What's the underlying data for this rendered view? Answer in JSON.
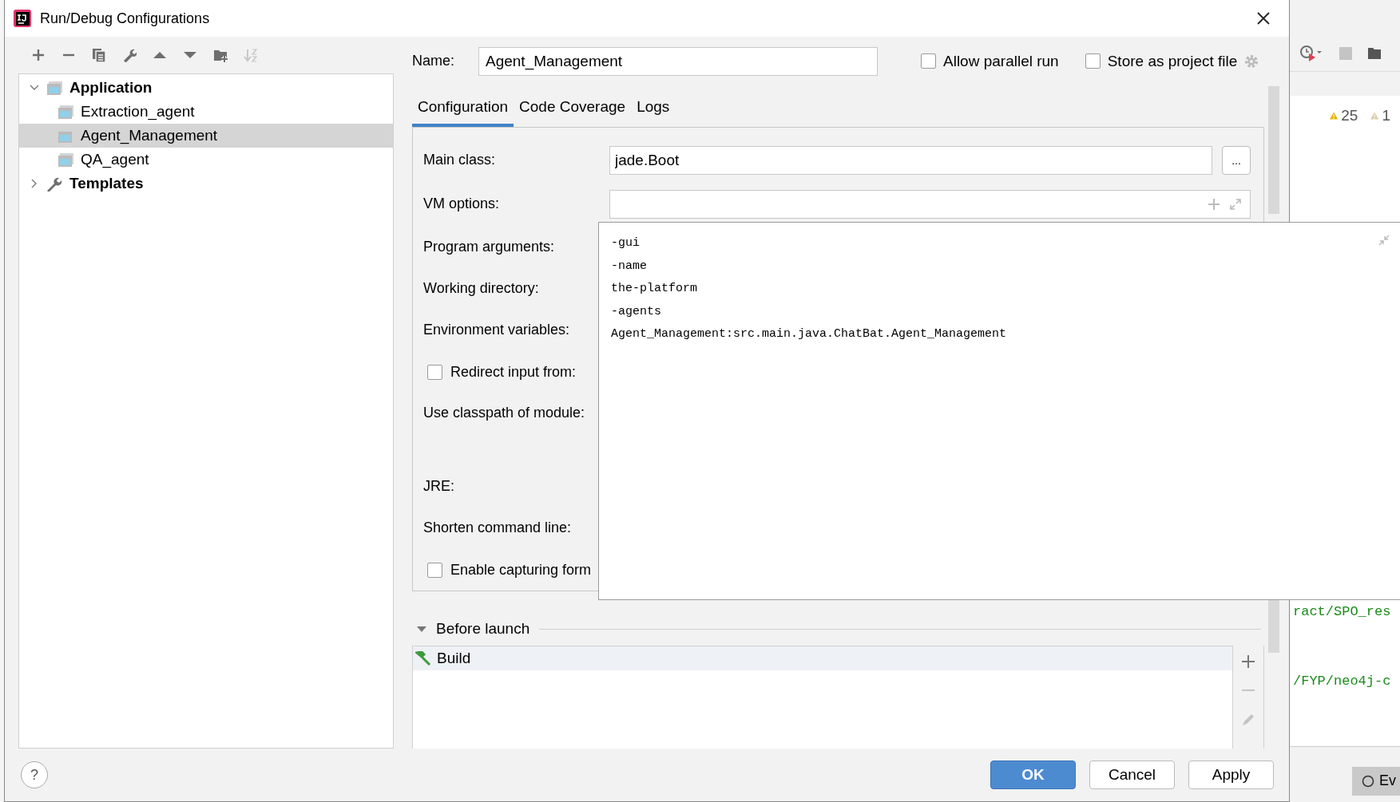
{
  "window": {
    "title": "Run/Debug Configurations"
  },
  "toolbar": [
    {
      "kind": "add",
      "disabled": false
    },
    {
      "kind": "remove",
      "disabled": false
    },
    {
      "kind": "copy",
      "disabled": false
    },
    {
      "kind": "edit",
      "disabled": false
    },
    {
      "kind": "up",
      "disabled": false
    },
    {
      "kind": "down",
      "disabled": false
    },
    {
      "kind": "folder",
      "disabled": false
    },
    {
      "kind": "sort",
      "disabled": true
    }
  ],
  "tree": [
    {
      "label": "Application",
      "kind": "application",
      "expanded": true,
      "selected": false,
      "children": [
        {
          "label": "Extraction_agent",
          "kind": "config",
          "selected": false
        },
        {
          "label": "Agent_Management",
          "kind": "config",
          "selected": true
        },
        {
          "label": "QA_agent",
          "kind": "config",
          "selected": false
        }
      ]
    },
    {
      "label": "Templates",
      "kind": "templates",
      "expanded": false,
      "selected": false
    }
  ],
  "name": {
    "label": "Name:",
    "value": "Agent_Management"
  },
  "options": [
    {
      "label": "Allow parallel run",
      "checked": false
    },
    {
      "label": "Store as project file",
      "checked": false
    }
  ],
  "tabs": [
    {
      "label": "Configuration",
      "selected": true
    },
    {
      "label": "Code Coverage",
      "selected": false
    },
    {
      "label": "Logs",
      "selected": false
    }
  ],
  "form": [
    {
      "kind": "field",
      "label": "Main class:",
      "value": "jade.Boot",
      "browse": "..."
    },
    {
      "kind": "expandable",
      "label": "VM options:"
    },
    {
      "kind": "label",
      "label": "Program arguments:"
    },
    {
      "kind": "label",
      "label": "Working directory:"
    },
    {
      "kind": "label",
      "label": "Environment variables:"
    },
    {
      "kind": "checkbox",
      "label": "Redirect input from:",
      "checked": false
    },
    {
      "kind": "module",
      "label": "Use classpath of module:"
    },
    {
      "kind": "label",
      "label": "JRE:"
    },
    {
      "kind": "label",
      "label": "Shorten command line:"
    },
    {
      "kind": "checkbox",
      "label": "Enable capturing form",
      "checked": false
    }
  ],
  "popup": {
    "lines": [
      "-gui",
      "-name",
      "the-platform",
      "-agents",
      "Agent_Management:src.main.java.ChatBat.Agent_Management"
    ]
  },
  "before_launch": {
    "title": "Before launch",
    "expanded": true,
    "tasks": [
      {
        "label": "Build",
        "selected": true
      }
    ]
  },
  "help": "?",
  "buttons": [
    {
      "label": "OK",
      "kind": "primary"
    },
    {
      "label": "Cancel",
      "kind": "normal"
    },
    {
      "label": "Apply",
      "kind": "normal"
    }
  ],
  "background": {
    "warnings": "25",
    "weak_warnings": "1",
    "code_lines": [
      "ract/SPO_res",
      "/FYP/neo4j-c"
    ],
    "tab": "Ev"
  }
}
